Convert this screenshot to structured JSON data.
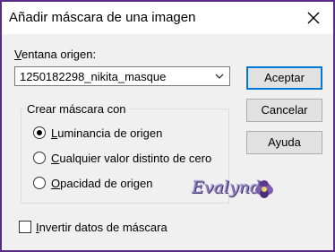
{
  "dialog": {
    "title": "Añadir máscara de una imagen",
    "source_label_prefix": "V",
    "source_label_rest": "entana origen:",
    "source_value": "1250182298_nikita_masque",
    "group_title": "Crear máscara con",
    "options": [
      {
        "first": "L",
        "rest": "uminancia de origen",
        "selected": true
      },
      {
        "first": "C",
        "rest": "ualquier valor distinto de cero",
        "selected": false
      },
      {
        "first": "O",
        "rest": "pacidad de origen",
        "selected": false
      }
    ],
    "invert_first": "I",
    "invert_rest": "nvertir datos de máscara",
    "invert_checked": false,
    "buttons": {
      "accept": "Aceptar",
      "cancel": "Cancelar",
      "help": "Ayuda"
    },
    "watermark": "Evalynda",
    "accent_color": "#0078d7",
    "border_color": "#5b2a86"
  }
}
